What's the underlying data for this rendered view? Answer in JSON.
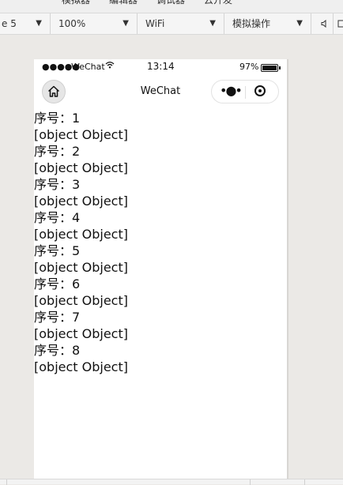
{
  "top_tabs": [
    "模拟器",
    "编辑器",
    "调试器",
    "云开发"
  ],
  "toolbar": {
    "device_select": "e 5",
    "zoom_select": "100%",
    "network_select": "WiFi",
    "operation_select": "模拟操作",
    "chevron_icon": "chevron-down-icon",
    "sound_icon": "speaker-icon",
    "rotate_icon": "rotate-icon"
  },
  "status_bar": {
    "signal": "●●●●●",
    "carrier": "WeChat",
    "wifi_icon": "wifi-icon",
    "time": "13:14",
    "battery_percent": "97%",
    "battery_level": 0.97
  },
  "nav_bar": {
    "title": "WeChat",
    "home_icon": "home-icon",
    "more_icon": "more-icon",
    "close_icon": "target-icon"
  },
  "content": {
    "lines": [
      "序号：1",
      "[object Object]",
      "序号：2",
      "[object Object]",
      "序号：3",
      "[object Object]",
      "序号：4",
      "[object Object]",
      "序号：5",
      "[object Object]",
      "序号：6",
      "[object Object]",
      "序号：7",
      "[object Object]",
      "序号：8",
      "[object Object]"
    ]
  }
}
